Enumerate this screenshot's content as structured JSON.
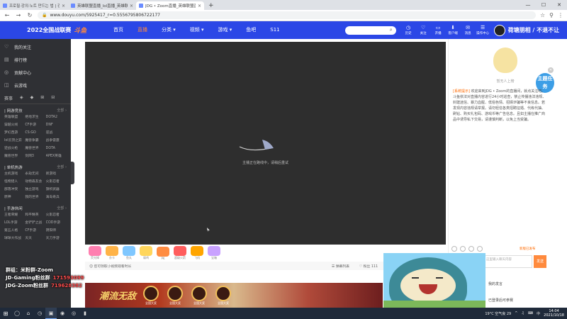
{
  "browser": {
    "tabs": [
      {
        "title": "프로필·강의·노트 만드는 법 | 강좌 ...",
        "active": false
      },
      {
        "title": "英雄联盟直播_lol直播_英雄联盟...",
        "active": false
      },
      {
        "title": "JDG • Zoom直播_英雄联盟直...",
        "active": true
      }
    ],
    "url": "www.douyu.com/5925417_r=0.5556795806722177",
    "new_tab": "+",
    "controls": {
      "minimize": "—",
      "maximize": "☐",
      "close": "✕"
    }
  },
  "site": {
    "logo_text": "2022全国战联赛",
    "logo_brand": "斗鱼",
    "nav": [
      {
        "label": "首页",
        "active": false
      },
      {
        "label": "直播",
        "active": true
      },
      {
        "label": "分类 ▾",
        "active": false
      },
      {
        "label": "视频 ▾",
        "active": false
      },
      {
        "label": "游戏 ▾",
        "active": false
      },
      {
        "label": "鱼吧",
        "active": false
      },
      {
        "label": "S11",
        "active": false
      }
    ],
    "search_placeholder": "",
    "header_actions": [
      {
        "icon": "◷",
        "label": "历史"
      },
      {
        "icon": "♡",
        "label": "关注"
      },
      {
        "icon": "▭",
        "label": "开播"
      },
      {
        "icon": "⬇",
        "label": "客户端"
      },
      {
        "icon": "✉",
        "label": "消息"
      },
      {
        "icon": "☰",
        "label": "操作中心"
      }
    ],
    "header_banner": "荷塘朋相 / 不退不让"
  },
  "sidebar": {
    "top": [
      {
        "icon": "♡",
        "label": "我的关注"
      },
      {
        "icon": "▤",
        "label": "排行榜"
      },
      {
        "icon": "◎",
        "label": "贡献中心"
      },
      {
        "icon": "◫",
        "label": "云游戏"
      }
    ],
    "icon_row": [
      "赛事",
      "◈",
      "◆",
      "⊞",
      "⊟"
    ],
    "categories": [
      {
        "title": "| 网游竞技",
        "all": "全部 ›",
        "items": [
          "英雄联盟",
          "绝地求生",
          "DOTA2",
          "穿越火线",
          "CF手游",
          "DNF",
          "梦幻西游",
          "CS:GO",
          "逆战",
          "lol云顶之弈",
          "魔兽争霸",
          "战争雷霆",
          "逆战火枪",
          "魔兽世界",
          "DOTA",
          "魔兽世界",
          "剑网3",
          "APEX英雄"
        ]
      },
      {
        "title": "| 单机热游",
        "all": "全部 ›",
        "items": [
          "主机游戏",
          "永劫无间",
          "新游戏",
          "怪物猎人",
          "动物森友会",
          "火影忍者",
          "部落冲突",
          "独立游戏",
          "旗帜武器",
          "原神",
          "我的世界",
          "海岛奇兵"
        ]
      },
      {
        "title": "| 手游休闲",
        "all": "全部 ›",
        "items": [
          "王者荣耀",
          "和平精英",
          "火影忍者",
          "LOL手游",
          "金铲铲之战",
          "COD手游",
          "第五人格",
          "CF手游",
          "阴阳师",
          "球球大作战",
          "天天",
          "天刀手游"
        ]
      }
    ]
  },
  "player": {
    "loading_text": "主播正在路线中，请稍后重试"
  },
  "gifts": [
    {
      "color": "#ff7fb0",
      "label": "荧光棒"
    },
    {
      "color": "#ffb347",
      "label": "办卡"
    },
    {
      "color": "#7fc7ff",
      "label": "鱼丸"
    },
    {
      "color": "#ffd65c",
      "label": "弱鸡"
    },
    {
      "color": "#ff8c42",
      "label": "PK"
    },
    {
      "color": "#ff5d5d",
      "label": "超级火箭"
    },
    {
      "color": "#ffa500",
      "label": "飞机"
    },
    {
      "color": "#c9a2ff",
      "label": "宝箱"
    }
  ],
  "control_bar": {
    "left": "☺ 您可领取小视频观看时长",
    "right": [
      "☰ 弹幕列表",
      "♡ 粉丝 111"
    ]
  },
  "overlay": [
    {
      "label": "群组：米粉群-Zoom",
      "number": ""
    },
    {
      "label": "JD-Gaming粉丝群",
      "number": "171593099"
    },
    {
      "label": "JDG-Zoom粉丝群",
      "number": "719628382"
    }
  ],
  "ad_banner": {
    "title": "潮流无敌",
    "captions": [
      "全国大奖",
      "全国大奖",
      "全国大奖",
      "全国大奖"
    ]
  },
  "right_panel": {
    "illustration_caption": "暂无人上榜",
    "task_label": "主题任务",
    "notice_tag": "[系统提示]",
    "notice": "欢迎来到JDG • Zoom的直播间，就点关注吧。斗鱼依法对直播内容进行24小时巡查，禁止传播违法违规、封建迷信、暴力血腥、低俗色情、招嫖诈骗等不良信息。若发现内容违规请举报。请勿轻信各类招聘征婚、代练代抽、刷钻、购买礼包码、游戏币等广告信息。且如主播在推广商品中诱导私下交易，请谨慎判断，以免上当受骗。",
    "tools_label": "新版已发布",
    "chat_placeholder": "这里输入聊天内容",
    "send_label": "发送",
    "login_text": "我的发言",
    "login_text2": "已登录后可参赛"
  },
  "taskbar": {
    "start": "⊞",
    "items": [
      "◯",
      "⌂",
      "◷",
      "▣",
      "◉",
      "◎",
      "▮"
    ],
    "weather": "19°C 空气良 29",
    "tray": [
      "^",
      "♫",
      "⌨",
      "中"
    ],
    "time": "14:04",
    "date": "2021/10/18"
  }
}
